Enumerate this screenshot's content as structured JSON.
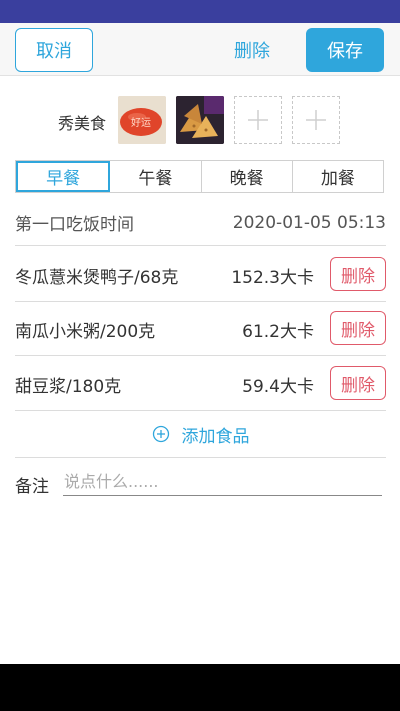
{
  "topbar": {
    "cancel_label": "取消",
    "delete_label": "删除",
    "save_label": "保存"
  },
  "photos": {
    "label": "秀美食",
    "photo1_caption": "好运"
  },
  "tabs": [
    {
      "label": "早餐",
      "active": true
    },
    {
      "label": "午餐"
    },
    {
      "label": "晚餐"
    },
    {
      "label": "加餐"
    }
  ],
  "time": {
    "label": "第一口吃饭时间",
    "value": "2020-01-05 05:13"
  },
  "foods": [
    {
      "name": "冬瓜薏米煲鸭子/68克",
      "calories": "152.3大卡",
      "delete_label": "删除"
    },
    {
      "name": "南瓜小米粥/200克",
      "calories": "61.2大卡",
      "delete_label": "删除"
    },
    {
      "name": "甜豆浆/180克",
      "calories": "59.4大卡",
      "delete_label": "删除"
    }
  ],
  "add_food": {
    "label": "添加食品",
    "icon": "plus-circle-icon"
  },
  "note": {
    "label": "备注",
    "placeholder": "说点什么......"
  },
  "colors": {
    "accent": "#2fa6dc",
    "danger": "#e05a6a",
    "status_bar": "#3a3f9e"
  }
}
